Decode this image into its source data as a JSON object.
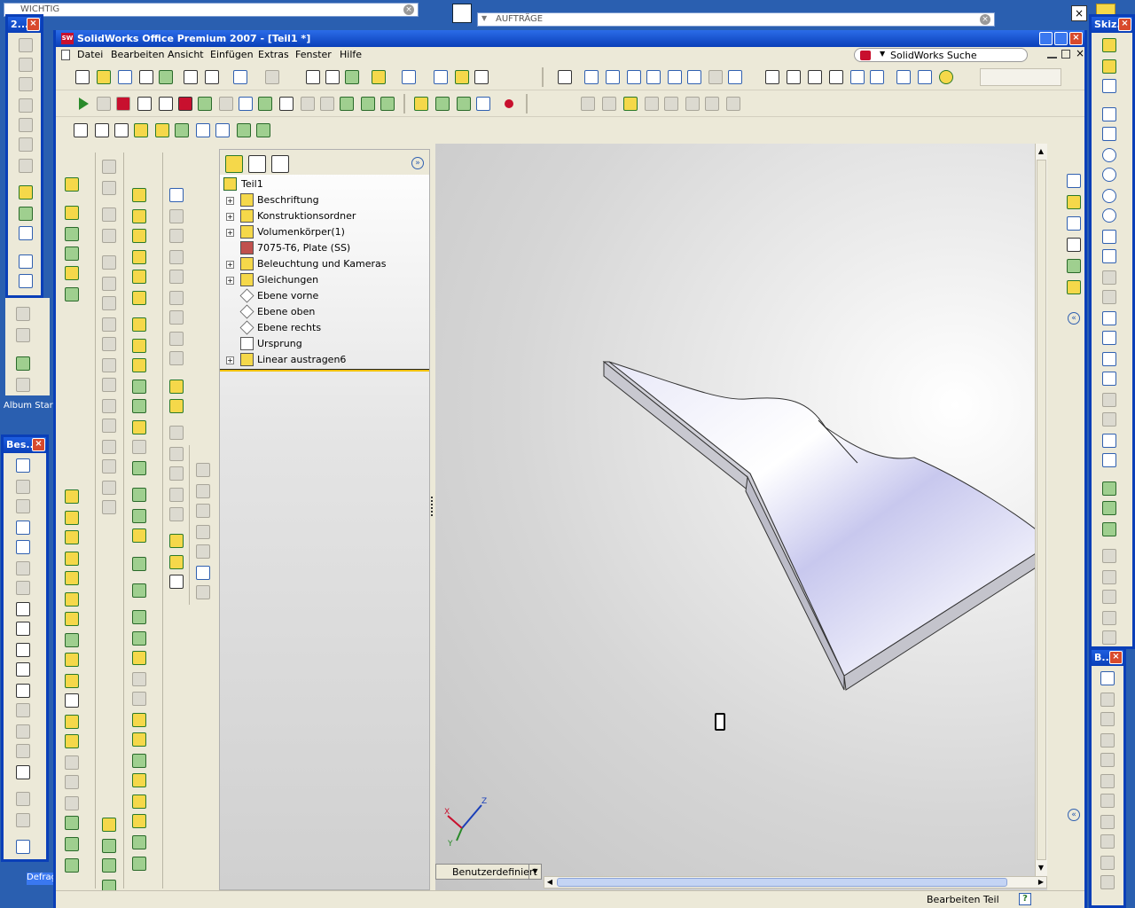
{
  "desktop": {
    "wichtig_label": "WICHTIG",
    "auftraege_label": "AUFTRÄGE",
    "album_label": "Album Start",
    "defrag_label": "Defrag"
  },
  "window": {
    "title": "SolidWorks Office Premium 2007 - [Teil1 *]",
    "logo": "SW"
  },
  "menu": [
    "Datei",
    "Bearbeiten",
    "Ansicht",
    "Einfügen",
    "Extras",
    "Fenster",
    "Hilfe"
  ],
  "search": {
    "placeholder": "SolidWorks Suche"
  },
  "float_left": {
    "title": "2..."
  },
  "float_bes": {
    "title": "Bes..."
  },
  "float_skiz": {
    "title": "Skiz..."
  },
  "float_b": {
    "title": "B..."
  },
  "tree": {
    "root": "Teil1",
    "items": [
      {
        "label": "Beschriftung",
        "expandable": true,
        "icon": "annotation-icon"
      },
      {
        "label": "Konstruktionsordner",
        "expandable": true,
        "icon": "design-folder-icon"
      },
      {
        "label": "Volumenkörper(1)",
        "expandable": true,
        "icon": "solid-bodies-icon"
      },
      {
        "label": "7075-T6, Plate (SS)",
        "expandable": false,
        "icon": "material-icon"
      },
      {
        "label": "Beleuchtung und Kameras",
        "expandable": true,
        "icon": "lights-cameras-icon"
      },
      {
        "label": "Gleichungen",
        "expandable": true,
        "icon": "equations-icon"
      },
      {
        "label": "Ebene vorne",
        "expandable": false,
        "icon": "plane-icon"
      },
      {
        "label": "Ebene oben",
        "expandable": false,
        "icon": "plane-icon"
      },
      {
        "label": "Ebene rechts",
        "expandable": false,
        "icon": "plane-icon"
      },
      {
        "label": "Ursprung",
        "expandable": false,
        "icon": "origin-icon"
      },
      {
        "label": "Linear austragen6",
        "expandable": true,
        "icon": "loft-feature-icon"
      }
    ]
  },
  "viewport": {
    "view_dropdown": "Benutzerdefiniert",
    "triad_labels": {
      "z": "Z",
      "x": "X",
      "y": "Y"
    }
  },
  "status": {
    "text": "Bearbeiten Teil",
    "help": "?"
  },
  "colors": {
    "xp_blue": "#0a3fb8",
    "toolbar_bg": "#ece9d8",
    "model_face": "#d8d8f0"
  }
}
